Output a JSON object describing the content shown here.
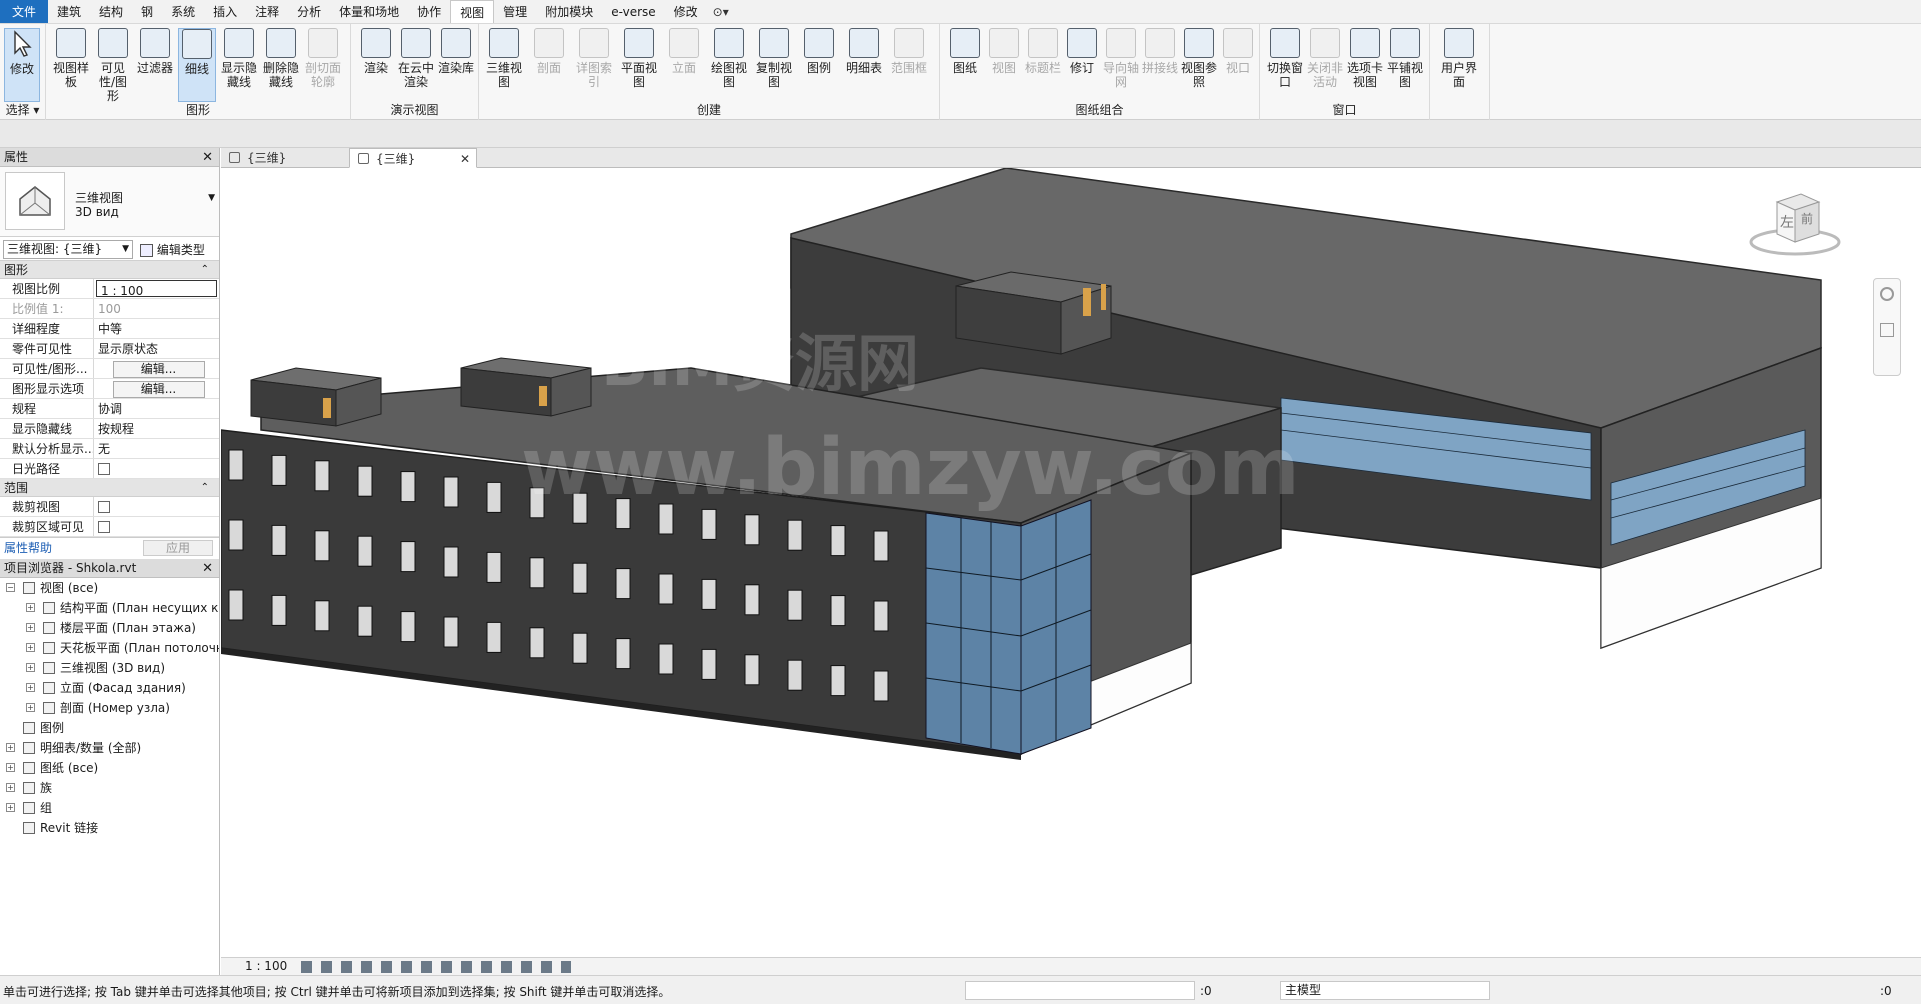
{
  "menu": {
    "tabs": [
      "文件",
      "建筑",
      "结构",
      "钢",
      "系统",
      "插入",
      "注释",
      "分析",
      "体量和场地",
      "协作",
      "视图",
      "管理",
      "附加模块",
      "e-verse",
      "修改"
    ],
    "active_tab": "视图",
    "extra": "⊙▾"
  },
  "ribbon": {
    "modify": {
      "label": "修改",
      "group": "选择"
    },
    "graphics": {
      "group": "图形",
      "buttons": [
        "视图样板",
        "可见性/图形",
        "过滤器",
        "细线",
        "显示隐藏线",
        "删除隐藏线",
        "剖切面轮廓"
      ]
    },
    "presentation": {
      "group": "演示视图",
      "buttons": [
        "渲染",
        "在云中渲染",
        "渲染库"
      ]
    },
    "create": {
      "group": "创建",
      "buttons": [
        "三维视图",
        "剖面",
        "详图索引",
        "平面视图",
        "立面",
        "绘图视图",
        "复制视图",
        "图例",
        "明细表",
        "范围框"
      ]
    },
    "sheet": {
      "group": "图纸组合",
      "buttons": [
        "图纸",
        "视图",
        "标题栏",
        "修订",
        "导向轴网",
        "拼接线",
        "视图参照",
        "视口"
      ]
    },
    "window": {
      "group": "窗口",
      "buttons": [
        "切换窗口",
        "关闭非活动",
        "选项卡视图",
        "平铺视图"
      ]
    },
    "ui": {
      "label": "用户界面"
    }
  },
  "properties": {
    "title": "属性",
    "type_name": "三维视图",
    "type_sub": "3D вид",
    "view_selector": "三维视图: {三维}",
    "edit_type": "编辑类型",
    "group_graphics": "图形",
    "rows": [
      {
        "k": "视图比例",
        "v": "1 : 100",
        "kind": "box"
      },
      {
        "k": "比例值 1:",
        "v": "100",
        "kind": "dim"
      },
      {
        "k": "详细程度",
        "v": "中等",
        "kind": "text"
      },
      {
        "k": "零件可见性",
        "v": "显示原状态",
        "kind": "text"
      },
      {
        "k": "可见性/图形...",
        "v": "编辑...",
        "kind": "btn"
      },
      {
        "k": "图形显示选项",
        "v": "编辑...",
        "kind": "btn"
      },
      {
        "k": "规程",
        "v": "协调",
        "kind": "text"
      },
      {
        "k": "显示隐藏线",
        "v": "按规程",
        "kind": "text"
      },
      {
        "k": "默认分析显示...",
        "v": "无",
        "kind": "text"
      },
      {
        "k": "日光路径",
        "v": "",
        "kind": "chk"
      }
    ],
    "group_extent": "范围",
    "extent_rows": [
      {
        "k": "裁剪视图",
        "v": "",
        "kind": "chk"
      },
      {
        "k": "裁剪区域可见",
        "v": "",
        "kind": "chk"
      }
    ],
    "help": "属性帮助",
    "apply": "应用"
  },
  "browser": {
    "title": "项目浏览器 - Shkola.rvt",
    "items": [
      {
        "label": "视图 (все)",
        "level": 0,
        "exp": "−"
      },
      {
        "label": "结构平面 (План несущих кон",
        "level": 1,
        "exp": "+"
      },
      {
        "label": "楼层平面 (План этажа)",
        "level": 1,
        "exp": "+"
      },
      {
        "label": "天花板平面 (План потолочно",
        "level": 1,
        "exp": "+"
      },
      {
        "label": "三维视图 (3D вид)",
        "level": 1,
        "exp": "+"
      },
      {
        "label": "立面 (Фасад здания)",
        "level": 1,
        "exp": "+"
      },
      {
        "label": "剖面 (Номер узла)",
        "level": 1,
        "exp": "+"
      },
      {
        "label": "图例",
        "level": 0,
        "exp": ""
      },
      {
        "label": "明细表/数量 (全部)",
        "level": 0,
        "exp": "+"
      },
      {
        "label": "图纸 (все)",
        "level": 0,
        "exp": "+"
      },
      {
        "label": "族",
        "level": 0,
        "exp": "+"
      },
      {
        "label": "组",
        "level": 0,
        "exp": "+"
      },
      {
        "label": "Revit 链接",
        "level": 0,
        "exp": ""
      }
    ]
  },
  "view_tabs": [
    {
      "label": "{三维}",
      "active": false
    },
    {
      "label": "{三维}",
      "active": true
    }
  ],
  "view_tab_close": "✕",
  "viewcube": {
    "left": "左",
    "front": "前"
  },
  "watermark": {
    "line1": "BIM资源网",
    "line2": "www.bimzyw.com"
  },
  "viewbar": {
    "scale": "1 : 100"
  },
  "status": {
    "message": "单击可进行选择; 按 Tab 键并单击可选择其他项目; 按 Ctrl 键并单击可将新项目添加到选择集; 按 Shift 键并单击可取消选择。",
    "worksets": ":0",
    "model": "主模型",
    "filter": ":0"
  }
}
